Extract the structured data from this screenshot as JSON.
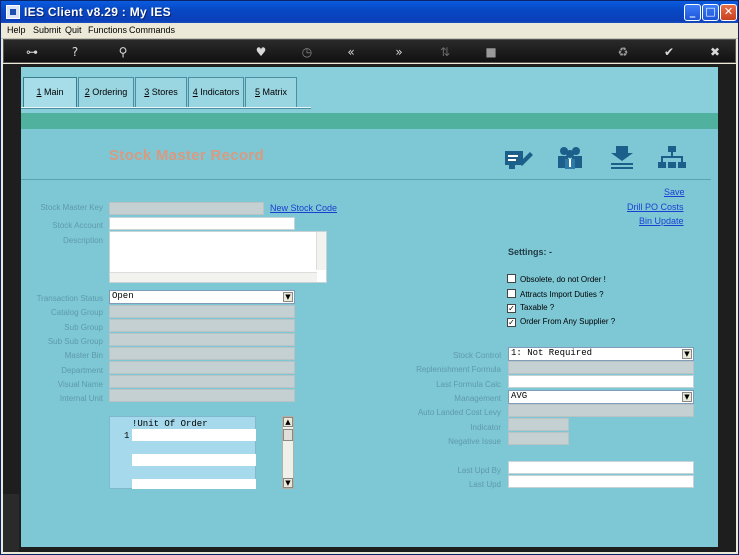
{
  "window": {
    "title": "IES Client v8.29 : My IES",
    "minimize_glyph": "_",
    "maximize_glyph": "□",
    "close_glyph": "✕"
  },
  "menu": [
    "Help",
    "Submit",
    "Quit",
    "Functions",
    "Commands"
  ],
  "toolbar": {
    "icons": [
      "key-icon",
      "help-icon",
      "search-icon",
      "heart-icon",
      "clock-icon",
      "rewind-icon",
      "fast-forward-icon",
      "sort-icon",
      "square-icon",
      "recycle-icon",
      "check-icon",
      "close-icon"
    ],
    "glyphs": [
      "⊶",
      "?",
      "⚲",
      "♥",
      "◷",
      "«",
      "»",
      "⇅",
      "■",
      "♻",
      "✔",
      "✖"
    ]
  },
  "tabs": [
    {
      "key": "1",
      "label": " Main"
    },
    {
      "key": "2",
      "label": " Ordering"
    },
    {
      "key": "3",
      "label": " Stores"
    },
    {
      "key": "4",
      "label": " Indicators"
    },
    {
      "key": "5",
      "label": " Matrix"
    }
  ],
  "record_title": "Stock Master Record",
  "header_icons": [
    "edit-record-icon",
    "users-icon",
    "download-icon",
    "hierarchy-icon"
  ],
  "links": {
    "new_stock_code": "New Stock Code",
    "save": "Save",
    "drill_po_costs": "Drill PO Costs",
    "bin_update": "Bin Update"
  },
  "left_fields": {
    "stock_master_key": "Stock Master Key",
    "stock_account": "Stock Account",
    "description": "Description",
    "transaction_status": "Transaction Status",
    "transaction_status_value": "Open",
    "catalog_group": "Catalog Group",
    "sub_group": "Sub Group",
    "sub_sub_group": "Sub Sub Group",
    "master_bin": "Master Bin",
    "department": "Department",
    "visual_name": "Visual Name",
    "internal_unit": "Internal Unit"
  },
  "settings": {
    "heading": "Settings: -",
    "options": [
      {
        "label": "Obsolete, do not Order !",
        "checked": false
      },
      {
        "label": "Attracts Import Duties ?",
        "checked": false
      },
      {
        "label": "Taxable ?",
        "checked": true
      },
      {
        "label": "Order From Any Supplier ?",
        "checked": true
      }
    ]
  },
  "right_fields": {
    "stock_control": "Stock Control",
    "stock_control_value": "1: Not Required",
    "replenishment_formula": "Replenishment Formula",
    "last_formula_calc": "Last Formula Calc",
    "management": "Management",
    "management_value": "AVG",
    "auto_landed_cost_levy": "Auto Landed Cost Levy",
    "indicator": "Indicator",
    "negative_issue": "Negative Issue",
    "last_upd_by": "Last Upd By",
    "last_upd": "Last Upd"
  },
  "grid": {
    "header": "!Unit Of Order",
    "row_number": "1"
  }
}
